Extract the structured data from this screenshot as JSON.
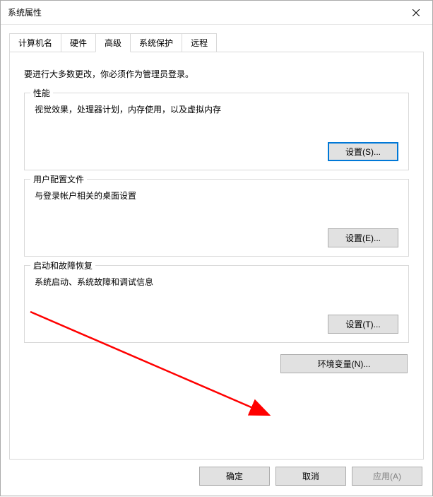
{
  "window": {
    "title": "系统属性"
  },
  "tabs": {
    "computer_name": "计算机名",
    "hardware": "硬件",
    "advanced": "高级",
    "system_protection": "系统保护",
    "remote": "远程"
  },
  "advanced_tab": {
    "intro": "要进行大多数更改，你必须作为管理员登录。",
    "performance": {
      "legend": "性能",
      "desc": "视觉效果，处理器计划，内存使用，以及虚拟内存",
      "settings_btn": "设置(S)..."
    },
    "user_profiles": {
      "legend": "用户配置文件",
      "desc": "与登录帐户相关的桌面设置",
      "settings_btn": "设置(E)..."
    },
    "startup_recovery": {
      "legend": "启动和故障恢复",
      "desc": "系统启动、系统故障和调试信息",
      "settings_btn": "设置(T)..."
    },
    "env_vars_btn": "环境变量(N)..."
  },
  "buttons": {
    "ok": "确定",
    "cancel": "取消",
    "apply": "应用(A)"
  }
}
